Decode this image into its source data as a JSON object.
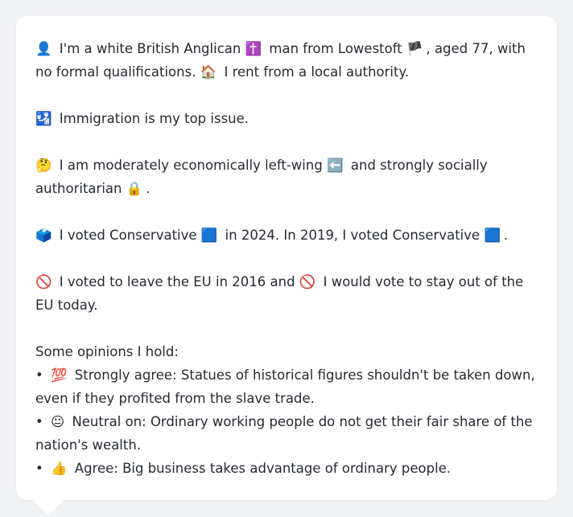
{
  "profile": {
    "line1": {
      "emoji1": "👤",
      "text1": "I'm a white British Anglican",
      "emoji2": "✝️",
      "text2": "man from Lowestoft",
      "emoji3": "🏴",
      "text3": ", aged 77, with no formal qualifications.",
      "emoji4": "🏠",
      "text4": "I rent from a local authority."
    },
    "line2": {
      "emoji": "🛂",
      "text": "Immigration is my top issue."
    },
    "line3": {
      "emoji1": "🤔",
      "text1": "I am moderately economically left-wing",
      "emoji2": "⬅️",
      "text2": "and strongly socially authoritarian",
      "emoji3": "🔒",
      "text3": "."
    },
    "line4": {
      "emoji1": "🗳️",
      "text1": "I voted Conservative",
      "emoji2": "🟦",
      "text2": "in 2024. In 2019, I voted Conservative",
      "emoji3": "🟦",
      "text3": "."
    },
    "line5": {
      "emoji1": "🚫",
      "text1": "I voted to leave the EU in 2016 and",
      "emoji2": "🚫",
      "text2": "I would vote to stay out of the EU today."
    },
    "opinions": {
      "heading": "Some opinions I hold:",
      "items": [
        {
          "bullet": "•",
          "emoji": "💯",
          "text": "Strongly agree: Statues of historical figures shouldn't be taken down, even if they profited from the slave trade."
        },
        {
          "bullet": "•",
          "emoji": "😐",
          "text": "Neutral on: Ordinary working people do not get their fair share of the nation's wealth."
        },
        {
          "bullet": "•",
          "emoji": "👍",
          "text": "Agree: Big business takes advantage of ordinary people."
        }
      ]
    }
  }
}
